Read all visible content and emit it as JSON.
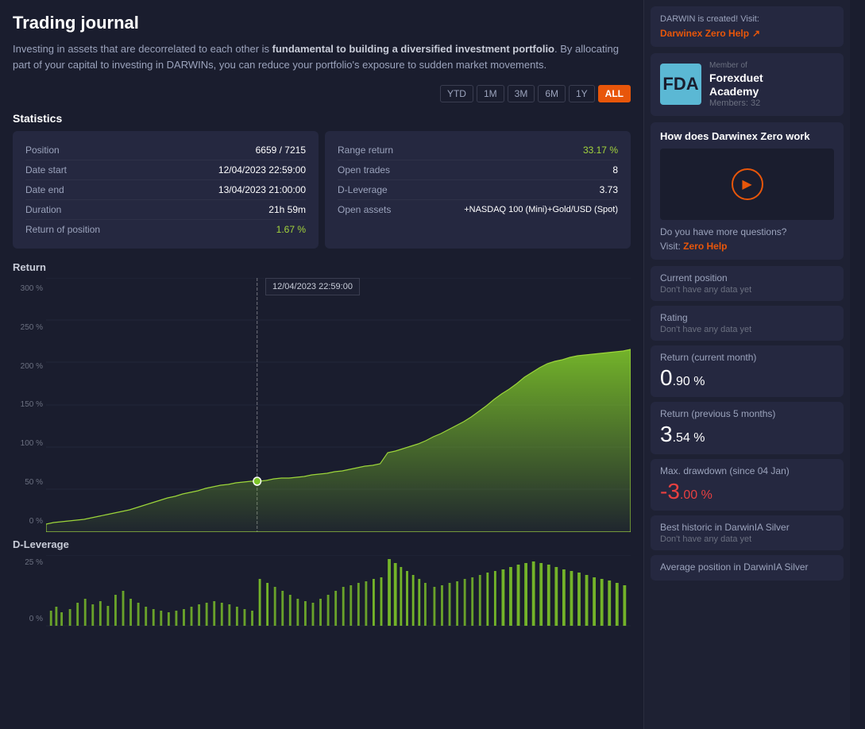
{
  "page": {
    "title": "Trading journal",
    "intro": {
      "part1": "Investing in assets that are decorrelated to each other is ",
      "bold": "fundamental to building a diversified investment portfolio",
      "part2": ". By allocating part of your capital to investing in DARWINs, you can reduce your portfolio's exposure to sudden market movements."
    }
  },
  "period_filters": {
    "options": [
      "YTD",
      "1M",
      "3M",
      "6M",
      "1Y",
      "ALL"
    ],
    "active": "ALL"
  },
  "statistics": {
    "label": "Statistics",
    "left_panel": [
      {
        "label": "Position",
        "value": "6659 / 7215",
        "type": "normal"
      },
      {
        "label": "Date start",
        "value": "12/04/2023 22:59:00",
        "type": "normal"
      },
      {
        "label": "Date end",
        "value": "13/04/2023 21:00:00",
        "type": "normal"
      },
      {
        "label": "Duration",
        "value": "21h 59m",
        "type": "normal"
      },
      {
        "label": "Return of position",
        "value": "1.67 %",
        "type": "green"
      }
    ],
    "right_panel": [
      {
        "label": "Range return",
        "value": "33.17 %",
        "type": "green"
      },
      {
        "label": "Open trades",
        "value": "8",
        "type": "normal"
      },
      {
        "label": "D-Leverage",
        "value": "3.73",
        "type": "normal"
      },
      {
        "label": "Open assets",
        "value": "+NASDAQ 100 (Mini)+Gold/USD (Spot)",
        "type": "normal"
      }
    ]
  },
  "chart": {
    "return_label": "Return",
    "y_labels": [
      "300 %",
      "250 %",
      "200 %",
      "150 %",
      "100 %",
      "50 %",
      "0 %"
    ],
    "tooltip_date": "12/04/2023",
    "tooltip_time": "22:59:00",
    "dleverage_label": "D-Leverage",
    "dleverage_y_labels": [
      "25 %",
      "0 %"
    ]
  },
  "sidebar": {
    "darwinex_zero_help_label": "Darwinex Zero Help",
    "member": {
      "of_label": "Member of",
      "logo_text": "FDA",
      "name_line1": "Forexduet",
      "name_line2": "Academy",
      "members": "Members: 32"
    },
    "how_section": {
      "title": "How does Darwinex Zero work",
      "questions": "Do you have more questions?",
      "visit_prefix": "Visit:",
      "zero_help": "Zero Help"
    },
    "current_position": {
      "title": "Current position",
      "no_data": "Don't have any data yet"
    },
    "rating": {
      "title": "Rating",
      "no_data": "Don't have any data yet"
    },
    "return_current_month": {
      "title": "Return (current month)",
      "value_whole": "0",
      "value_decimal": ".90 %"
    },
    "return_prev_5_months": {
      "title": "Return (previous 5 months)",
      "value_whole": "3",
      "value_decimal": ".54 %"
    },
    "max_drawdown": {
      "title": "Max. drawdown (since 04 Jan)",
      "value_whole": "-3",
      "value_decimal": ".00 %"
    },
    "best_historic": {
      "title": "Best historic in DarwinIA Silver",
      "no_data": "Don't have any data yet"
    },
    "avg_position": {
      "title": "Average position in DarwinIA Silver"
    }
  }
}
